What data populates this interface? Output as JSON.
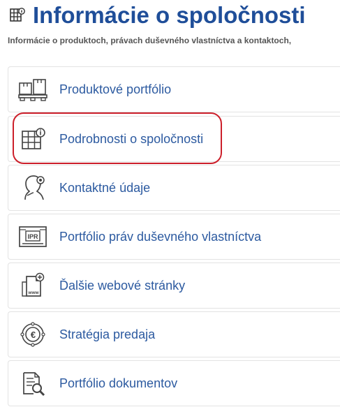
{
  "header": {
    "title": "Informácie o spoločnosti",
    "subtitle": "Informácie o produktoch, právach duševného vlastníctva a kontaktoch,",
    "icon": "company-grid-icon"
  },
  "menu": {
    "items": [
      {
        "label": "Produktové portfólio",
        "icon": "pallet-boxes-icon"
      },
      {
        "label": "Podrobnosti o spoločnosti",
        "icon": "building-info-icon"
      },
      {
        "label": "Kontaktné údaje",
        "icon": "person-location-icon"
      },
      {
        "label": "Portfólio práv duševného vlastníctva",
        "icon": "ipr-document-icon"
      },
      {
        "label": "Ďalšie webové stránky",
        "icon": "www-page-add-icon"
      },
      {
        "label": "Stratégia predaja",
        "icon": "euro-coin-icon"
      },
      {
        "label": "Portfólio dokumentov",
        "icon": "document-search-icon"
      }
    ],
    "highlighted_item": "Podrobnosti o spoločnosti"
  },
  "colors": {
    "title": "#1f4e99",
    "link": "#2c5aa0",
    "subtitle": "#555555",
    "highlight_ring": "#cc1f2a",
    "item_border": "#e3e3e3"
  }
}
